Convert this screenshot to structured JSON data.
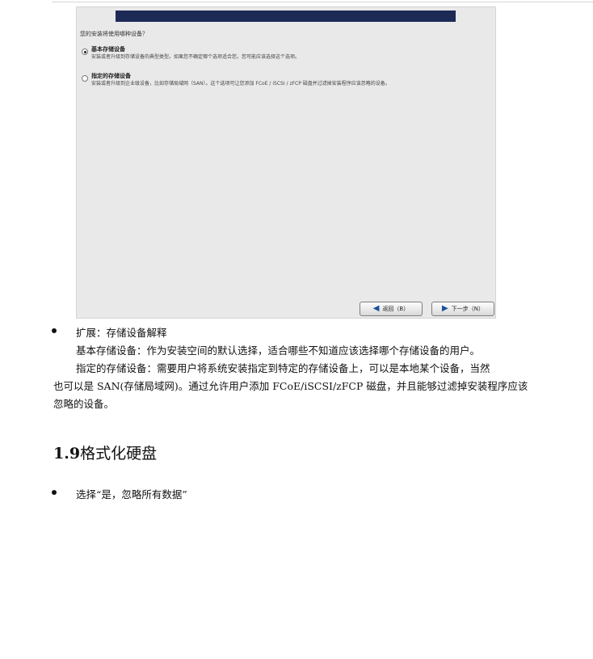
{
  "installer": {
    "question": "您的安装将使用哪种设备？",
    "options": [
      {
        "title": "基本存储设备",
        "description": "安装或者升级到存储设备的典型类型。如果您不确定哪个选项适合您，您可能应该选择这个选项。",
        "selected": true
      },
      {
        "title": "指定的存储设备",
        "description": "安装或者升级到企业级设备，比如存储局域网（SAN）。这个选项可让您添加 FCoE / iSCSI / zFCP 磁盘并过滤掉安装程序应该忽略的设备。",
        "selected": false
      }
    ],
    "back_button": "返回（B）",
    "next_button": "下一步（N）",
    "back_icon": "arrow-left-icon",
    "next_icon": "arrow-right-icon",
    "banner_color": "#1c2a55"
  },
  "doc": {
    "bullet1": "扩展：存储设备解释",
    "para1": "基本存储设备：作为安装空间的默认选择，适合哪些不知道应该选择哪个存储设备的用户。",
    "para2_line1": "指定的存储设备：需要用户将系统安装指定到特定的存储设备上，可以是本地某个设备，当然",
    "para2_line2": "也可以是 SAN(存储局域网)。通过允许用户添加 FCoE/iSCSI/zFCP 磁盘，并且能够过滤掉安装程序应该",
    "para2_line3": "忽略的设备。",
    "section_number": "1.9",
    "section_title": "格式化硬盘",
    "bullet2": "选择“是，忽略所有数据”"
  }
}
